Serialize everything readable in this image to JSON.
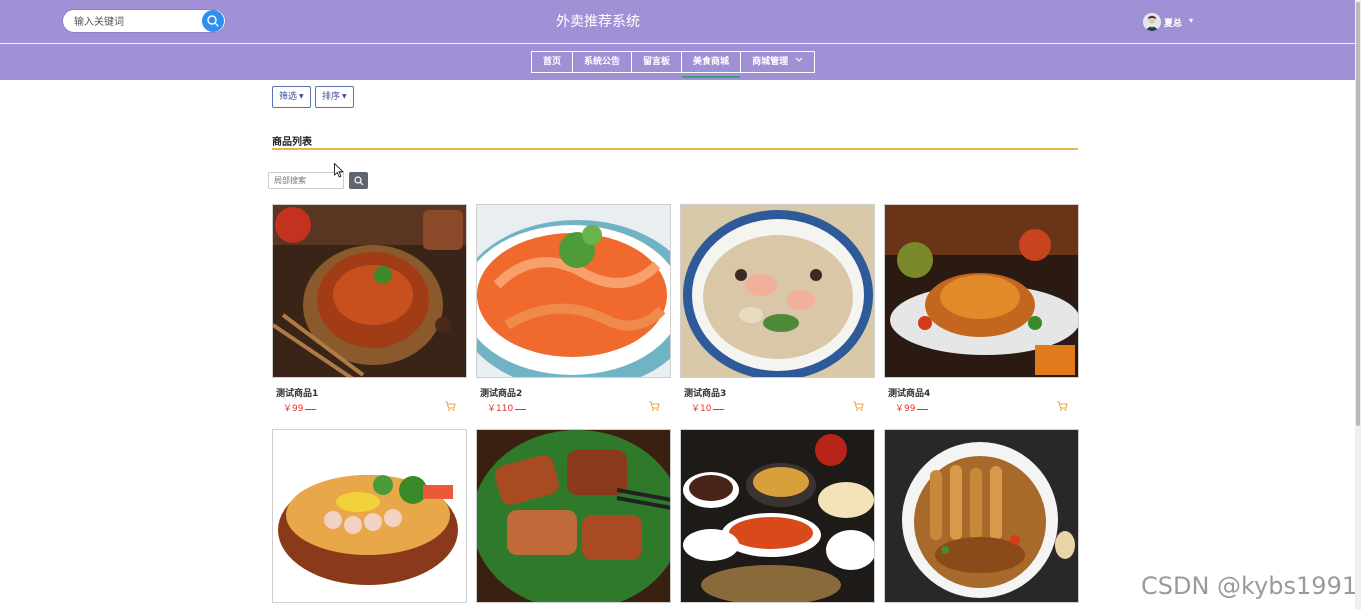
{
  "header": {
    "search_placeholder": "输入关键词",
    "title": "外卖推荐系统",
    "user_name": "夏总",
    "user_caret": "▾"
  },
  "nav": {
    "items": [
      {
        "label": "首页"
      },
      {
        "label": "系统公告"
      },
      {
        "label": "留言板"
      },
      {
        "label": "美食商城",
        "active": true
      },
      {
        "label": "商城管理"
      }
    ]
  },
  "toolbar": {
    "filter_label": "筛选",
    "sort_label": "排序"
  },
  "section": {
    "title": "商品列表",
    "local_search_placeholder": "局部搜索"
  },
  "products": [
    {
      "name": "测试商品1",
      "price": "￥99"
    },
    {
      "name": "测试商品2",
      "price": "￥110"
    },
    {
      "name": "测试商品3",
      "price": "￥10"
    },
    {
      "name": "测试商品4",
      "price": "￥99"
    },
    {
      "name": "",
      "price": ""
    },
    {
      "name": "",
      "price": ""
    },
    {
      "name": "",
      "price": ""
    },
    {
      "name": "",
      "price": ""
    }
  ],
  "watermark": "CSDN @kybs1991",
  "colors": {
    "header_bg": "#a091d6",
    "accent_blue": "#2f8ff0",
    "price_red": "#e3342f",
    "section_line": "#e4b653",
    "nav_active_underline": "#34a37a"
  },
  "icons": [
    "search-icon",
    "chevron-down-icon",
    "cart-icon",
    "avatar"
  ]
}
